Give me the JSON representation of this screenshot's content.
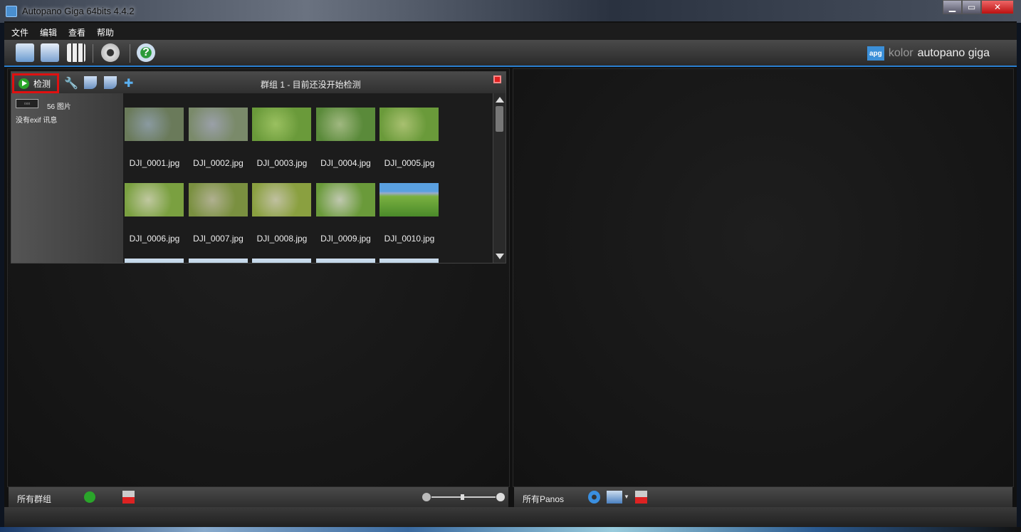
{
  "window": {
    "title": "Autopano Giga 64bits 4.4.2",
    "min": "▁",
    "max": "▭",
    "close": "✕"
  },
  "menu": [
    "文件",
    "编辑",
    "查看",
    "帮助"
  ],
  "brand": {
    "logo": "apg",
    "kolor": "kolor",
    "name": "autopano giga"
  },
  "group": {
    "detect_label": "检测",
    "title": "群组 1 - 目前还没开始检测",
    "grid_glyph": "▫▫▫",
    "image_count": "56 图片",
    "exif": "没有exif 讯息",
    "images": [
      "DJI_0001.jpg",
      "DJI_0002.jpg",
      "DJI_0003.jpg",
      "DJI_0004.jpg",
      "DJI_0005.jpg",
      "DJI_0006.jpg",
      "DJI_0007.jpg",
      "DJI_0008.jpg",
      "DJI_0009.jpg",
      "DJI_0010.jpg"
    ]
  },
  "bottom_left": {
    "label": "所有群组"
  },
  "bottom_right": {
    "label": "所有Panos"
  },
  "colors": {
    "accent": "#2a7fd0",
    "highlight": "#e01010",
    "play": "#2aa52a"
  }
}
